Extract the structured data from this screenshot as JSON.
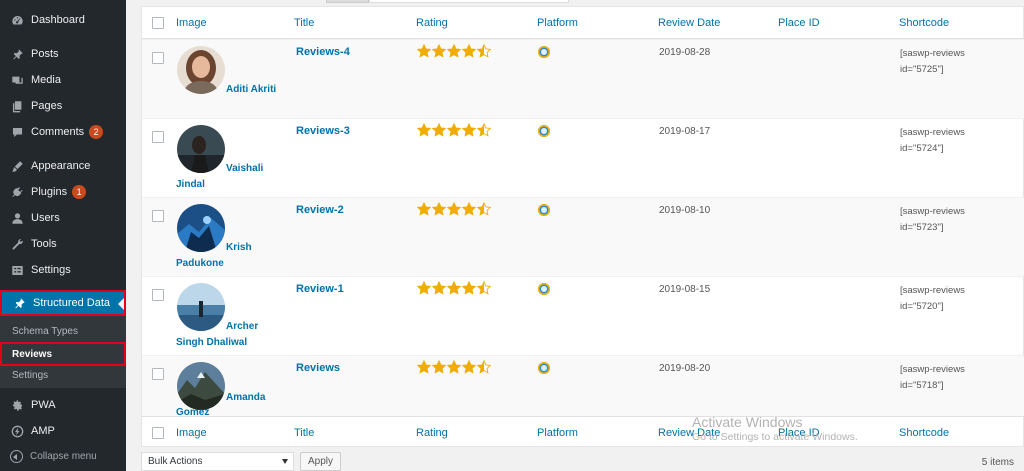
{
  "sidebar": {
    "items": [
      {
        "label": "Dashboard",
        "icon": "dashboard-icon"
      },
      {
        "label": "Posts",
        "icon": "pin-icon"
      },
      {
        "label": "Media",
        "icon": "media-icon"
      },
      {
        "label": "Pages",
        "icon": "pages-icon"
      },
      {
        "label": "Comments",
        "icon": "comment-icon",
        "badge": "2"
      },
      {
        "label": "Appearance",
        "icon": "brush-icon"
      },
      {
        "label": "Plugins",
        "icon": "plugin-icon",
        "badge": "1"
      },
      {
        "label": "Users",
        "icon": "user-icon"
      },
      {
        "label": "Tools",
        "icon": "wrench-icon"
      },
      {
        "label": "Settings",
        "icon": "settings-icon"
      }
    ],
    "active": {
      "label": "Structured Data",
      "icon": "pin-icon"
    },
    "submenu": [
      "Schema Types",
      "Reviews",
      "Settings"
    ],
    "after": [
      {
        "label": "PWA",
        "icon": "gear-icon"
      },
      {
        "label": "AMP",
        "icon": "bolt-icon"
      }
    ],
    "collapse": "Collapse menu"
  },
  "table": {
    "columns": [
      "Image",
      "Title",
      "Rating",
      "Platform",
      "Review Date",
      "Place ID",
      "Shortcode"
    ],
    "rows": [
      {
        "author": "Aditi Akriti",
        "author_l1": "Aditi Akriti",
        "author_l2": "",
        "title": "Reviews-4",
        "rating": 4.5,
        "date": "2019-08-28",
        "sc1": "[saswp-reviews",
        "sc2": "id=\"5725\"]"
      },
      {
        "author": "Vaishali Jindal",
        "author_l1": "Vaishali",
        "author_l2": "Jindal",
        "title": "Reviews-3",
        "rating": 4.5,
        "date": "2019-08-17",
        "sc1": "[saswp-reviews",
        "sc2": "id=\"5724\"]"
      },
      {
        "author": "Krish Padukone",
        "author_l1": "Krish",
        "author_l2": "Padukone",
        "title": "Review-2",
        "rating": 4.5,
        "date": "2019-08-10",
        "sc1": "[saswp-reviews",
        "sc2": "id=\"5723\"]"
      },
      {
        "author": "Archer Singh Dhaliwal",
        "author_l1": "Archer",
        "author_l2": "Singh Dhaliwal",
        "title": "Review-1",
        "rating": 4.5,
        "date": "2019-08-15",
        "sc1": "[saswp-reviews",
        "sc2": "id=\"5720\"]"
      },
      {
        "author": "Amanda Gomez",
        "author_l1": "Amanda",
        "author_l2": "Gomez",
        "title": "Reviews",
        "rating": 4.5,
        "date": "2019-08-20",
        "sc1": "[saswp-reviews",
        "sc2": "id=\"5718\"]"
      }
    ]
  },
  "bottom": {
    "bulk_actions": "Bulk Actions",
    "apply": "Apply",
    "items_count": "5 items"
  },
  "watermark": {
    "line1": "Activate Windows",
    "line2": "Go to Settings to activate Windows."
  },
  "colors": {
    "accent": "#0073aa",
    "sidebar_bg": "#23282d",
    "highlight_border": "#e3001b",
    "star": "#f0ad00"
  }
}
